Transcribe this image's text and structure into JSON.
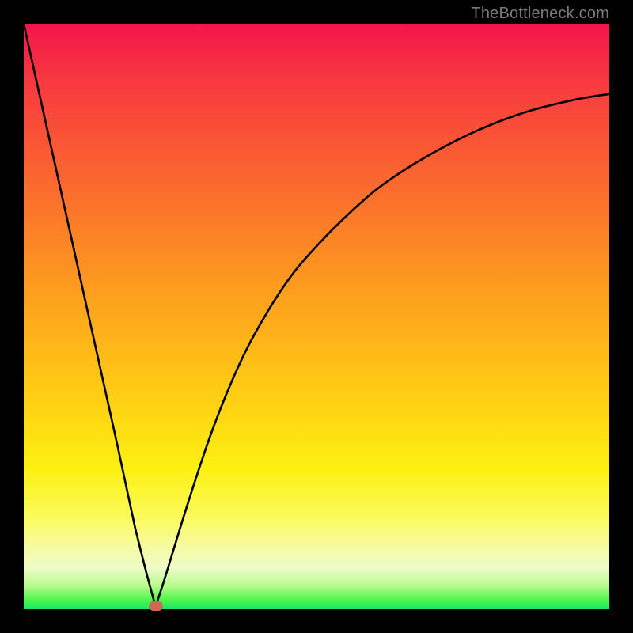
{
  "attribution": "TheBottleneck.com",
  "colors": {
    "frame": "#000000",
    "curve": "#000000",
    "marker": "#cd6a55",
    "gradient_top": "#f3154a",
    "gradient_bottom": "#18e86a",
    "attribution_text": "#7a7a7a"
  },
  "chart_data": {
    "type": "line",
    "title": "",
    "xlabel": "",
    "ylabel": "",
    "xlim": [
      0,
      100
    ],
    "ylim": [
      0,
      100
    ],
    "grid": false,
    "legend": false,
    "annotations": [],
    "background": "vertical-gradient red-to-green (bottleneck heatmap)",
    "series": [
      {
        "name": "bottleneck-curve",
        "description": "V-shaped curve. Left branch: steep near-linear descent from top-left to the minimum. Right branch: rises from the minimum with decreasing slope, concave-down, approaching the upper-right.",
        "x": [
          0,
          4,
          8,
          12,
          16,
          19,
          21,
          22.5,
          24,
          28,
          32,
          36,
          40,
          45,
          50,
          56,
          62,
          70,
          78,
          86,
          94,
          100
        ],
        "y": [
          100,
          82,
          64,
          46,
          28,
          14,
          6,
          0.5,
          5,
          18,
          30,
          40,
          48,
          56,
          62,
          68,
          73,
          78,
          82,
          85,
          87,
          88
        ]
      }
    ],
    "marker": {
      "x": 22.5,
      "y": 0.5,
      "shape": "rounded-rect",
      "label": ""
    }
  }
}
